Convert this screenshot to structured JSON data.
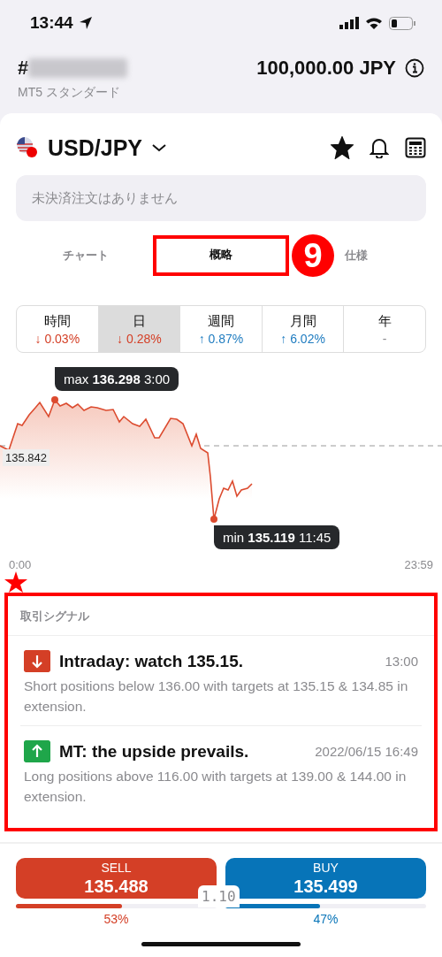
{
  "status_bar": {
    "time": "13:44"
  },
  "account": {
    "number_prefix": "#",
    "balance": "100,000.00 JPY",
    "type": "MT5 スタンダード"
  },
  "instrument": {
    "symbol": "USD/JPY",
    "favorite": true
  },
  "orders_notice": "未決済注文はありません",
  "tabs": [
    {
      "label": "チャート",
      "selected": false,
      "highlighted": false
    },
    {
      "label": "概略",
      "selected": true,
      "highlighted": true
    },
    {
      "label": "仕様",
      "selected": false,
      "highlighted": false
    }
  ],
  "annotation_badge": "9",
  "periods": [
    {
      "label": "時間",
      "change": "↓ 0.03%",
      "kind": "down",
      "selected": false
    },
    {
      "label": "日",
      "change": "↓ 0.28%",
      "kind": "down",
      "selected": true
    },
    {
      "label": "週間",
      "change": "↑ 0.87%",
      "kind": "up",
      "selected": false
    },
    {
      "label": "月間",
      "change": "↑ 6.02%",
      "kind": "up",
      "selected": false
    },
    {
      "label": "年",
      "change": "-",
      "kind": "none",
      "selected": false
    }
  ],
  "chart": {
    "max_label": "max **136.298** 3:00",
    "min_label": "min **135.119** 11:45",
    "open_price": "135.842",
    "x_start": "0:00",
    "x_end": "23:59"
  },
  "signals": {
    "title": "取引シグナル",
    "highlighted": true,
    "items": [
      {
        "kind": "down",
        "headline": "Intraday: watch 135.15.",
        "time": "13:00",
        "text": "Short positions below 136.00 with targets at 135.15 & 134.85 in extension."
      },
      {
        "kind": "up",
        "headline": "MT: the upside prevails.",
        "time": "2022/06/15 16:49",
        "text": "Long positions above 116.00 with targets at 139.00 & 144.00 in extension."
      }
    ]
  },
  "trade": {
    "sell": {
      "label": "SELL",
      "price": "135.488",
      "level": 0.53,
      "reading": "53%"
    },
    "spread": "1.10",
    "buy": {
      "label": "BUY",
      "price": "135.499",
      "level": 0.47,
      "reading": "47%"
    }
  }
}
